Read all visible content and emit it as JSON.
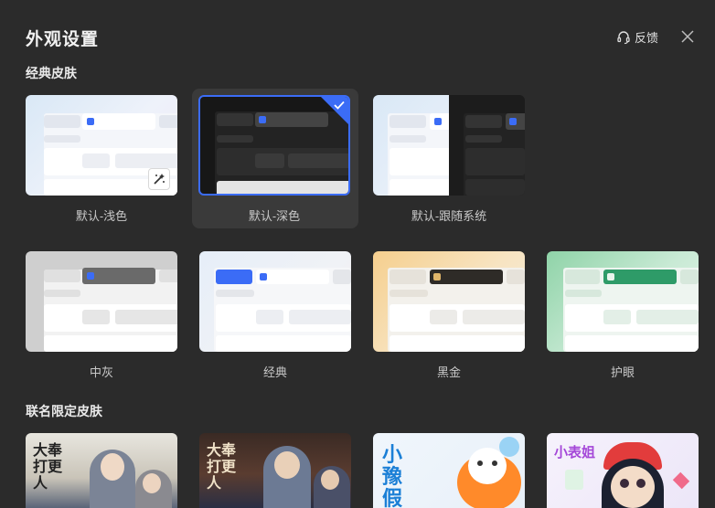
{
  "header": {
    "title": "外观设置",
    "feedback_label": "反馈"
  },
  "sections": {
    "classic": "经典皮肤",
    "collab": "联名限定皮肤"
  },
  "skins": [
    {
      "label": "默认-浅色"
    },
    {
      "label": "默认-深色",
      "selected": true
    },
    {
      "label": "默认-跟随系统"
    },
    {
      "label": "中灰"
    },
    {
      "label": "经典"
    },
    {
      "label": "黑金"
    },
    {
      "label": "护眼"
    }
  ],
  "collab_skins": [
    {
      "title": "大奉打更人"
    },
    {
      "title": "大奉打更人"
    },
    {
      "title": "小豫假"
    },
    {
      "title": "小表姐"
    }
  ],
  "colors": {
    "accent": "#3b6cf6",
    "background": "#2b2b2b",
    "gold": "#e0b66a",
    "green": "#2e9b68"
  }
}
